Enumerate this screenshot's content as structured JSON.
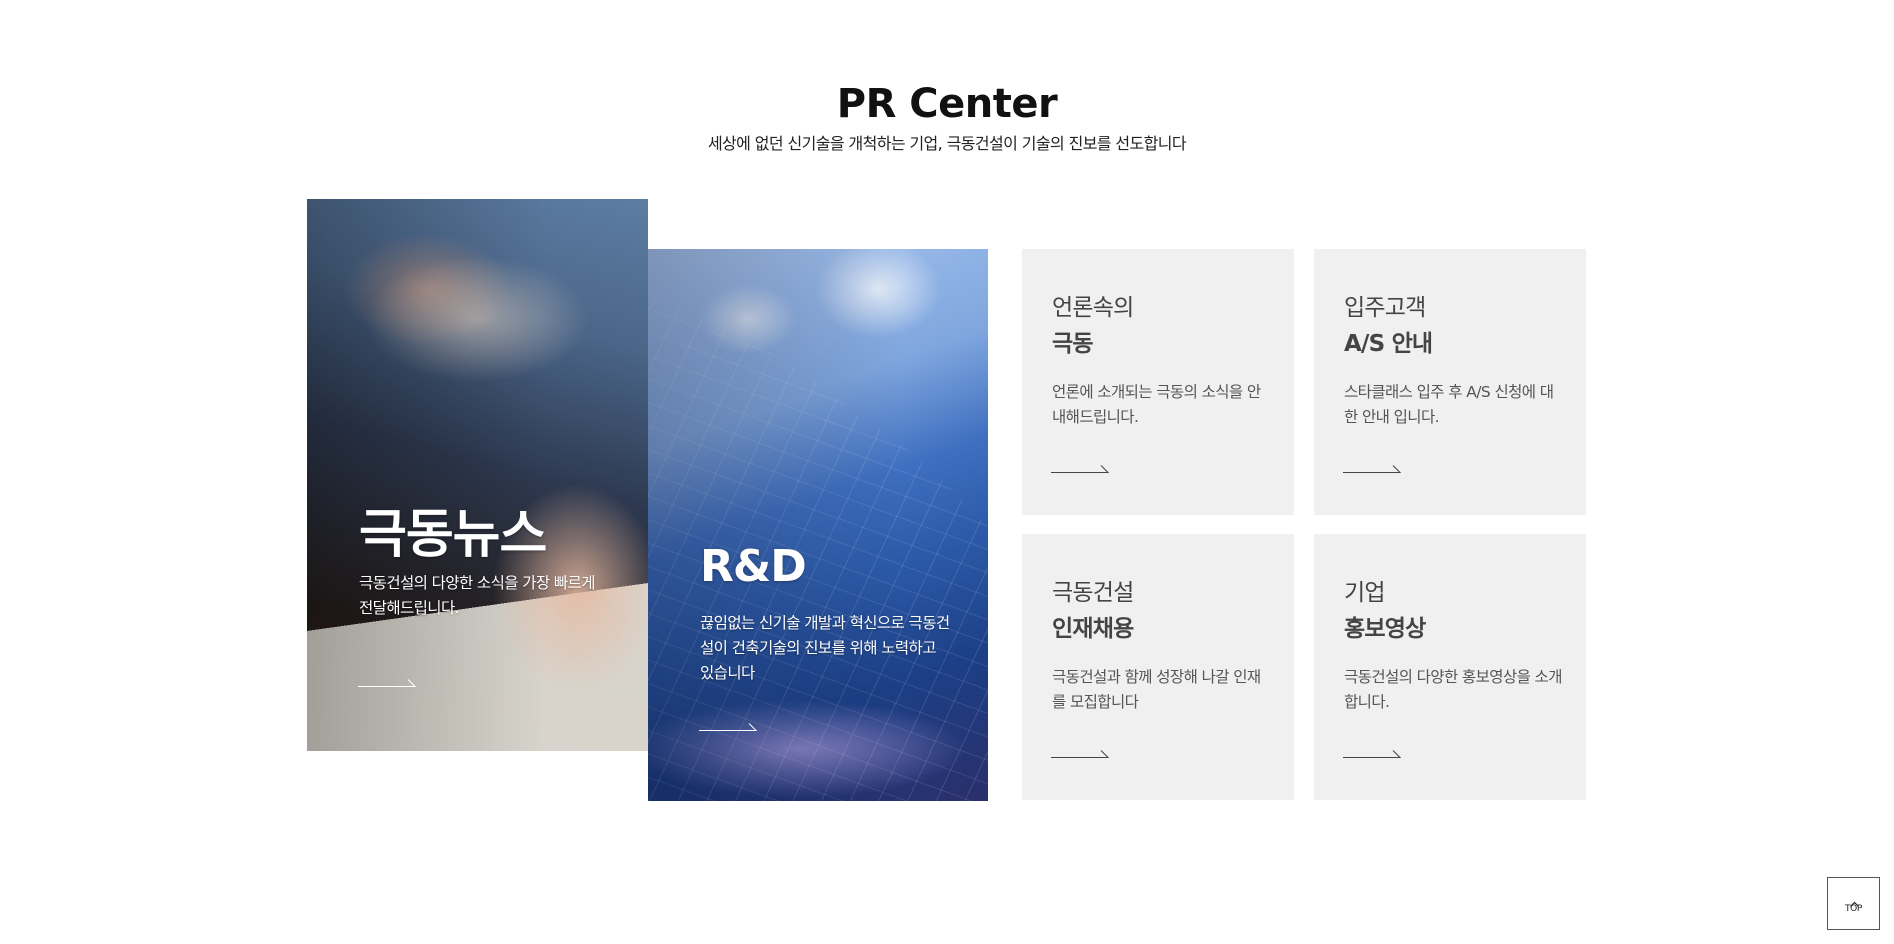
{
  "section": {
    "title": "PR Center",
    "subtitle": "세상에 없던 신기술을 개척하는 기업, 극동건설이 기술의 진보를 선도합니다"
  },
  "photo_cards": [
    {
      "heading": "극동뉴스",
      "description": "극동건설의 다양한 소식을 가장 빠르게 전달해드립니다."
    },
    {
      "heading": "R&D",
      "description": "끊임없는 신기술 개발과 혁신으로 극동건설이 건축기술의 진보를 위해 노력하고 있습니다"
    }
  ],
  "info_cards": [
    {
      "line1": "언론속의",
      "line2": "극동",
      "description": "언론에 소개되는 극동의 소식을 안내해드립니다."
    },
    {
      "line1": "입주고객",
      "line2": "A/S 안내",
      "description": "스타클래스 입주 후 A/S 신청에 대한 안내 입니다."
    },
    {
      "line1": "극동건설",
      "line2": "인재채용",
      "description": "극동건설과 함께 성장해 나갈 인재를 모집합니다"
    },
    {
      "line1": "기업",
      "line2": "홍보영상",
      "description": "극동건설의 다양한 홍보영상을 소개합니다."
    }
  ],
  "top_button": {
    "label": "TOP",
    "icon": "chevron-up-icon"
  },
  "colors": {
    "card_bg": "#f0f0f0",
    "text_dark": "#444444",
    "white": "#ffffff"
  }
}
